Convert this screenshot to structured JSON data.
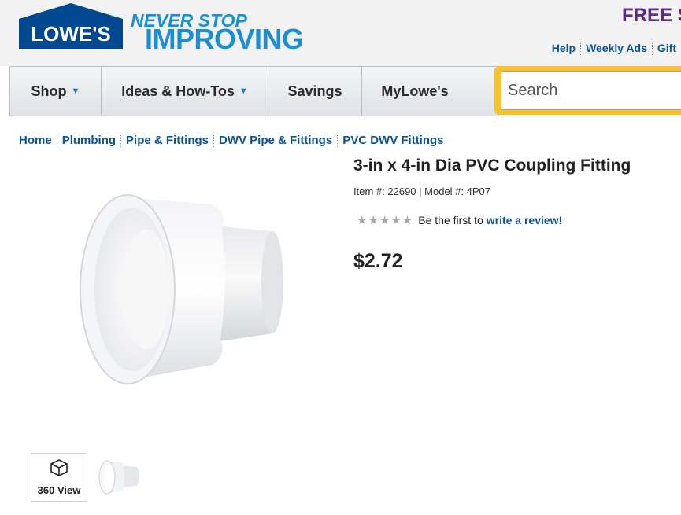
{
  "header": {
    "logo_text": "LOWE'S",
    "tagline_line1": "NEVER STOP",
    "tagline_line2": "IMPROVING",
    "promo_text": "FREE S",
    "links": [
      "Help",
      "Weekly Ads",
      "Gift"
    ]
  },
  "nav": {
    "items": [
      {
        "label": "Shop",
        "has_dropdown": true
      },
      {
        "label": "Ideas & How-Tos",
        "has_dropdown": true
      },
      {
        "label": "Savings",
        "has_dropdown": false
      },
      {
        "label": "MyLowe's",
        "has_dropdown": false
      }
    ],
    "search_placeholder": "Search"
  },
  "breadcrumb": [
    "Home",
    "Plumbing",
    "Pipe & Fittings",
    "DWV Pipe & Fittings",
    "PVC DWV Fittings"
  ],
  "product": {
    "title": "3-in x 4-in Dia PVC Coupling Fitting",
    "item_label": "Item #:",
    "item_number": "22690",
    "model_label": "Model #:",
    "model_number": "4P07",
    "rating_stars": 0,
    "rating_max": 5,
    "review_prompt": "Be the first to",
    "review_link": "write a review!",
    "price": "$2.72",
    "thumb_360_label": "360 View"
  },
  "colors": {
    "brand_blue": "#004990",
    "tagline_blue": "#1a8fd6",
    "link_blue": "#0b5394",
    "promo_purple": "#5a2a8a",
    "search_border": "#f5c332"
  }
}
